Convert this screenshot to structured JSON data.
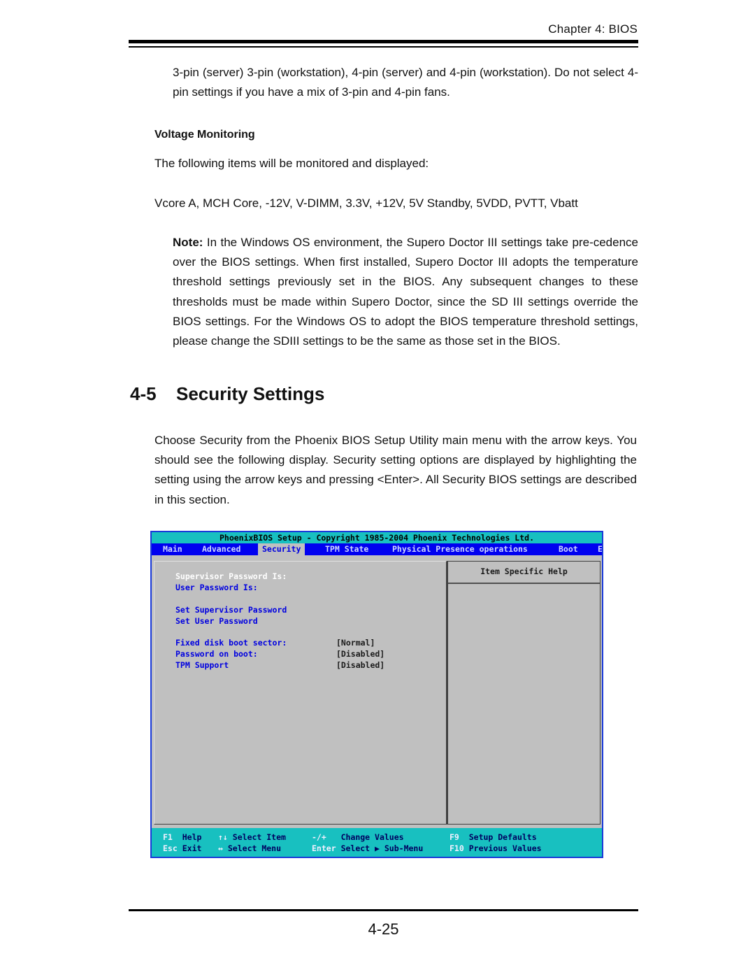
{
  "header": {
    "chapter": "Chapter 4: BIOS"
  },
  "body": {
    "fan_paragraph": "3-pin (server) 3-pin (workstation), 4-pin (server) and 4-pin (workstation). Do not select 4-pin settings if you have a mix of 3-pin and 4-pin fans.",
    "voltage_heading": "Voltage Monitoring",
    "voltage_intro": "The following items will be monitored and displayed:",
    "voltage_items": "Vcore A, MCH Core, -12V, V-DIMM, 3.3V, +12V, 5V Standby, 5VDD, PVTT, Vbatt",
    "note_label": "Note:",
    "note_text": " In the Windows OS environment, the Supero Doctor III settings take pre-cedence over the BIOS settings. When first installed, Supero Doctor III adopts the temperature threshold settings previously set in the BIOS. Any subsequent changes to these thresholds must be made within Supero Doctor, since the SD III settings override the BIOS settings. For the Windows OS to adopt the BIOS temperature threshold settings, please change the SDIII settings to be the same as those set in the BIOS.",
    "section_number": "4-5",
    "section_title": "Security Settings",
    "section_intro": "Choose Security from the Phoenix BIOS Setup Utility main menu with the arrow keys. You should see the following display. Security setting options are displayed by highlighting the setting using the arrow keys and pressing <Enter>. All Security BIOS settings are described in this section."
  },
  "bios": {
    "title": "PhoenixBIOS Setup - Copyright 1985-2004 Phoenix Technologies Ltd.",
    "menu": [
      "Main",
      "Advanced",
      "Security",
      "TPM State",
      "Physical Presence operations",
      "Boot",
      "E"
    ],
    "active_menu": "Security",
    "items": [
      {
        "label": "Supervisor Password Is:",
        "value": "",
        "selected": true
      },
      {
        "label": "User Password Is:",
        "value": ""
      },
      {
        "label": "Set Supervisor Password",
        "value": ""
      },
      {
        "label": "Set User Password",
        "value": ""
      },
      {
        "label": "Fixed disk boot sector:",
        "value": "[Normal]"
      },
      {
        "label": "Password on boot:",
        "value": "[Disabled]"
      },
      {
        "label": "TPM Support",
        "value": "[Disabled]"
      }
    ],
    "help_title": "Item Specific Help",
    "footer": {
      "row1": [
        {
          "key": "F1",
          "desc": "Help"
        },
        {
          "key": "↑↓",
          "desc": "Select Item"
        },
        {
          "key": "-/+",
          "desc": "Change Values"
        },
        {
          "key": "F9",
          "desc": "Setup Defaults"
        }
      ],
      "row2": [
        {
          "key": "Esc",
          "desc": "Exit"
        },
        {
          "key": "↔",
          "desc": "Select Menu"
        },
        {
          "key": "Enter",
          "desc": "Select ▶ Sub-Menu"
        },
        {
          "key": "F10",
          "desc": "Previous Values"
        }
      ]
    }
  },
  "footer": {
    "page_number": "4-25"
  }
}
